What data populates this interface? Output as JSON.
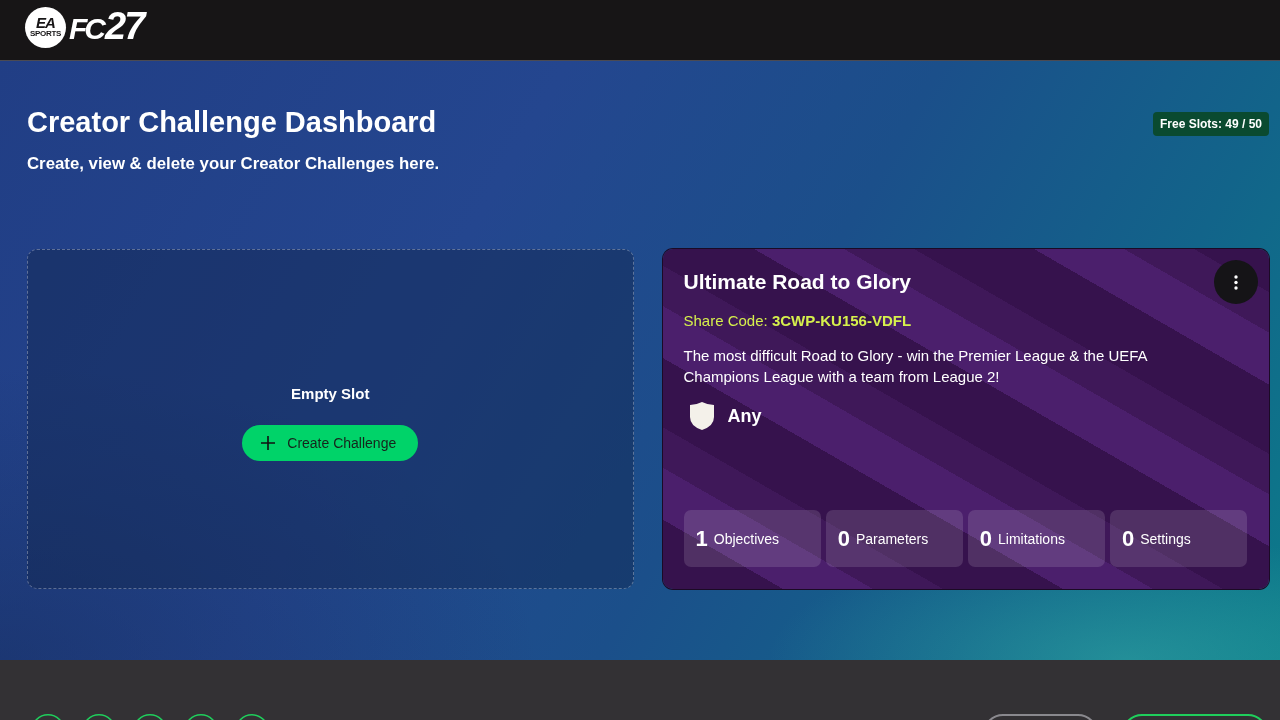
{
  "header": {
    "logo": {
      "badge_top": "EA",
      "badge_bottom": "SPORTS",
      "mark": "FC",
      "year": "27"
    }
  },
  "page": {
    "title": "Creator Challenge Dashboard",
    "subtitle": "Create, view & delete your Creator Challenges here.",
    "free_slots": "Free Slots: 49 / 50"
  },
  "slots": [
    {
      "kind": "empty",
      "label": "Empty Slot",
      "button": "Create Challenge"
    },
    {
      "kind": "challenge",
      "title": "Ultimate Road to Glory",
      "share_code": "Share Code: **3CWP-KU156-VDFL**",
      "description": "The most difficult Road to Glory - win the Premier League & the UEFA Champions League with a team from League 2!",
      "team": "Any",
      "stats": [
        {
          "count": "1",
          "label": "Objectives"
        },
        {
          "count": "0",
          "label": "Parameters"
        },
        {
          "count": "0",
          "label": "Limitations"
        },
        {
          "count": "0",
          "label": "Settings"
        }
      ]
    }
  ],
  "footer": {
    "steps": [
      {
        "kind": "round"
      },
      {
        "kind": "round"
      },
      {
        "kind": "round"
      },
      {
        "kind": "round"
      },
      {
        "kind": "round"
      }
    ],
    "buttons": [
      {
        "kind": "secondary"
      },
      {
        "kind": "primary"
      }
    ]
  }
}
